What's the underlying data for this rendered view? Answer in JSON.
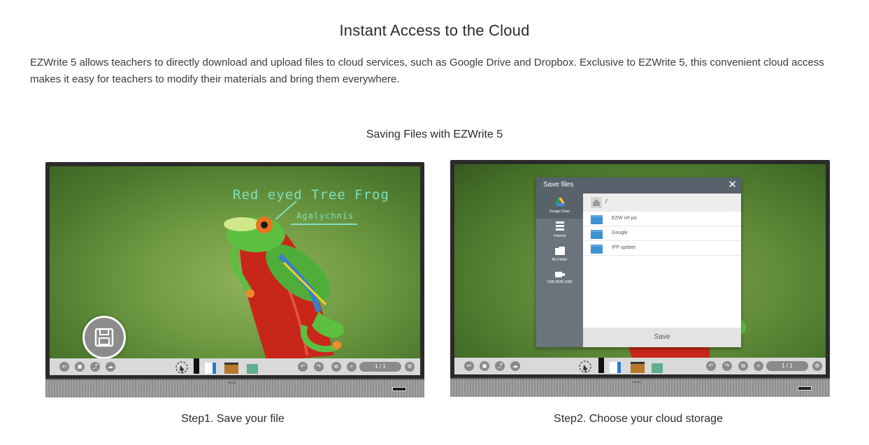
{
  "header": {
    "title": "Instant Access to the Cloud",
    "description_line1": "EZWrite 5 allows teachers to directly download and upload files to cloud services, such as Google Drive and Dropbox. Exclusive to EZWrite 5, this convenient cloud access",
    "description_line2": "makes it easy for teachers to modify their materials and bring them everywhere."
  },
  "section": {
    "subtitle": "Saving Files with EZWrite 5"
  },
  "step1": {
    "caption": "Step1. Save your file",
    "handwriting_title": "Red eyed Tree Frog",
    "handwriting_sub": "Agalychnis",
    "page_indicator": "1 / 1",
    "brand": "BenQ"
  },
  "step2": {
    "caption": "Step2. Choose your cloud storage",
    "page_indicator": "1 / 1",
    "brand": "BenQ",
    "dialog": {
      "title": "Save files",
      "close": "✕",
      "path": "/",
      "sidebar": [
        {
          "label": "Google Drive",
          "icon": "google-drive-icon"
        },
        {
          "label": "Internal",
          "icon": "internal-storage-icon"
        },
        {
          "label": "My Folder",
          "icon": "folder-icon"
        },
        {
          "label": "USB 3E85-1080",
          "icon": "usb-icon"
        }
      ],
      "files": [
        {
          "name": "EZW ref pic"
        },
        {
          "name": "Google"
        },
        {
          "name": "IFP update"
        }
      ],
      "save_label": "Save"
    }
  },
  "colors": {
    "accent_teal": "#7fe0c0",
    "dialog_header": "#58626c",
    "folder_blue": "#3e92d1"
  }
}
